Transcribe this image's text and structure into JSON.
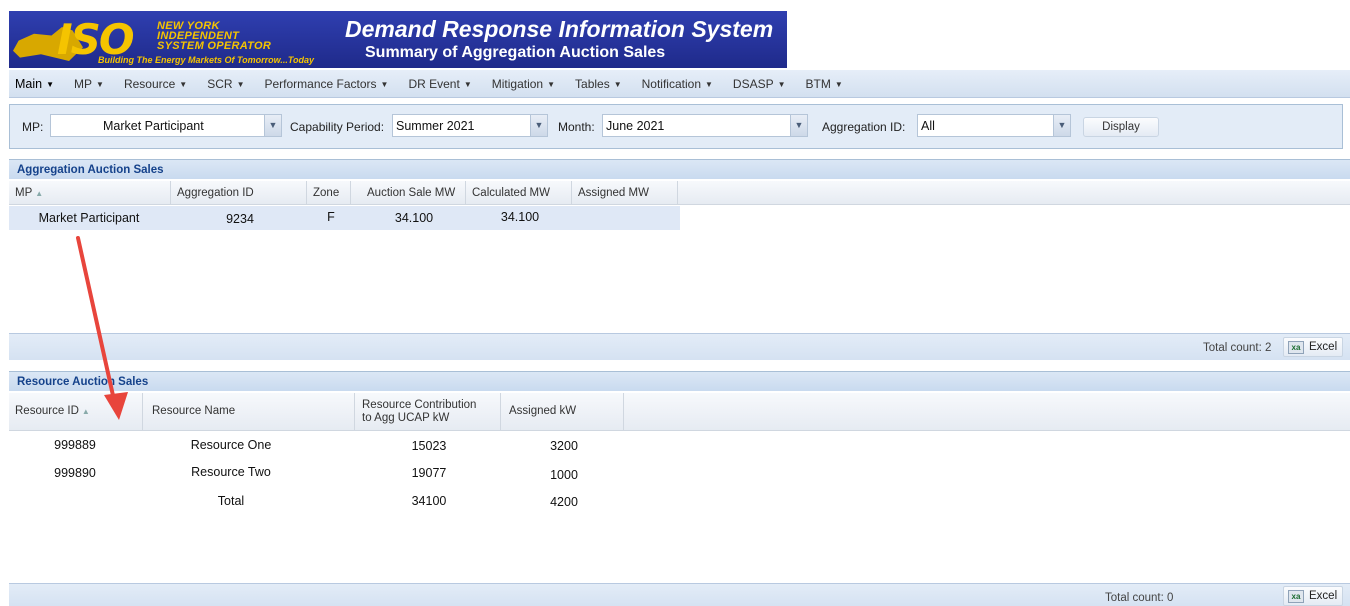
{
  "header": {
    "logo_text": "ISO",
    "logo_org_line1": "NEW YORK",
    "logo_org_line2": "INDEPENDENT",
    "logo_org_line3": "SYSTEM OPERATOR",
    "logo_tagline": "Building The Energy Markets Of Tomorrow...Today",
    "title": "Demand Response Information System",
    "subtitle": "Summary of Aggregation Auction Sales"
  },
  "menu": [
    {
      "label": "Main"
    },
    {
      "label": "MP"
    },
    {
      "label": "Resource"
    },
    {
      "label": "SCR"
    },
    {
      "label": "Performance Factors"
    },
    {
      "label": "DR Event"
    },
    {
      "label": "Mitigation"
    },
    {
      "label": "Tables"
    },
    {
      "label": "Notification"
    },
    {
      "label": "DSASP"
    },
    {
      "label": "BTM"
    }
  ],
  "filters": {
    "mp_label": "MP:",
    "mp_value": "Market Participant",
    "capability_label": "Capability Period:",
    "capability_value": "Summer 2021",
    "month_label": "Month:",
    "month_value": "June 2021",
    "aggregation_label": "Aggregation ID:",
    "aggregation_value": "All",
    "display_button": "Display"
  },
  "aggregation": {
    "title": "Aggregation Auction Sales",
    "columns": [
      "MP",
      "Aggregation ID",
      "Zone",
      "Auction Sale MW",
      "Calculated MW",
      "Assigned MW"
    ],
    "rows": [
      [
        "Market Participant",
        "9234",
        "F",
        "34.100",
        "34.100",
        ""
      ]
    ],
    "total_count": "Total count: 2",
    "excel_label": "Excel"
  },
  "resource": {
    "title": "Resource Auction Sales",
    "columns": [
      "Resource ID",
      "Resource Name",
      "Resource Contribution to Agg UCAP kW",
      "Assigned kW"
    ],
    "column_line1": "Resource Contribution",
    "column_line2": "to Agg UCAP kW",
    "rows": [
      [
        "999889",
        "Resource One",
        "15023",
        "3200"
      ],
      [
        "999890",
        "Resource Two",
        "19077",
        "1000"
      ],
      [
        "",
        "Total",
        "34100",
        "4200"
      ]
    ],
    "total_count": "Total count: 0",
    "excel_label": "Excel"
  },
  "colors": {
    "banner": "#2b3aa0",
    "logo_gold": "#f5c400",
    "panel_title": "#15428b",
    "arrow": "#e8453c"
  }
}
